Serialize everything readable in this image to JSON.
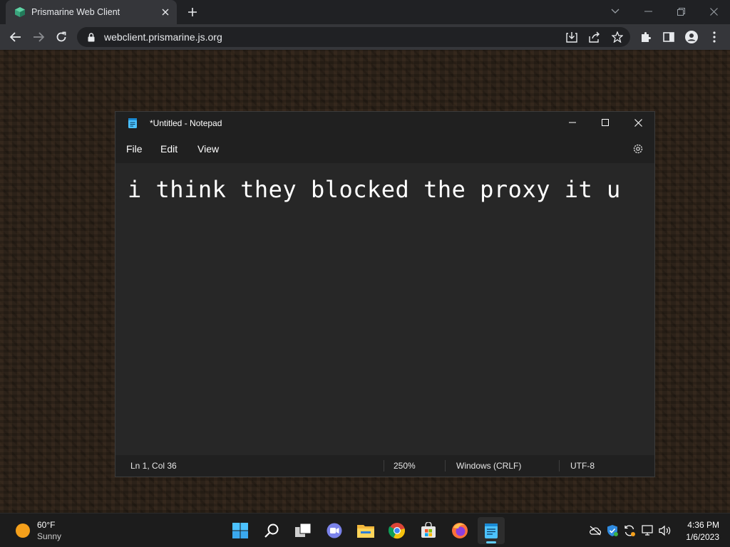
{
  "browser": {
    "tab_title": "Prismarine Web Client",
    "url": "webclient.prismarine.js.org"
  },
  "notepad": {
    "title": "*Untitled - Notepad",
    "menu": [
      "File",
      "Edit",
      "View"
    ],
    "content": "i think they blocked the proxy it u",
    "status": {
      "position": "Ln 1, Col 36",
      "zoom": "250%",
      "line_ending": "Windows (CRLF)",
      "encoding": "UTF-8"
    }
  },
  "taskbar": {
    "weather": {
      "temp": "60°F",
      "condition": "Sunny"
    },
    "apps": [
      "start-icon",
      "search-icon",
      "task-view-icon",
      "chat-icon",
      "file-explorer-icon",
      "chrome-icon",
      "store-icon",
      "firefox-icon",
      "notepad-icon"
    ],
    "clock": {
      "time": "4:36 PM",
      "date": "1/6/2023"
    }
  },
  "colors": {
    "accent": "#60cdff",
    "chrome_bg": "#202124",
    "chrome_toolbar": "#35363a",
    "notepad_bg": "#272727"
  }
}
